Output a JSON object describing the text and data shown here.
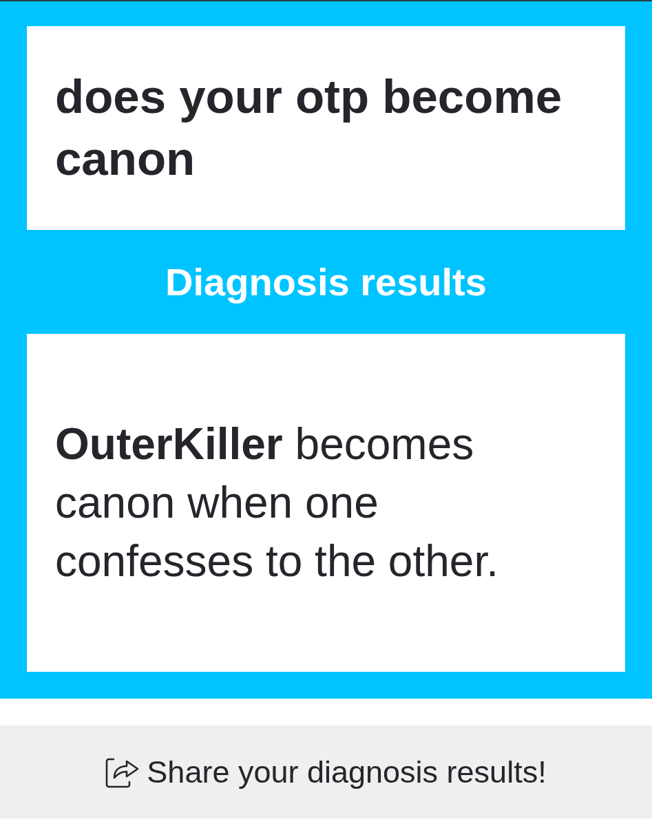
{
  "quiz": {
    "title": "does your otp become canon"
  },
  "results": {
    "heading": "Diagnosis results",
    "text": "**OuterKiller** becomes canon when one confesses to the other."
  },
  "share_button": {
    "label": "Share your diagnosis results!"
  }
}
